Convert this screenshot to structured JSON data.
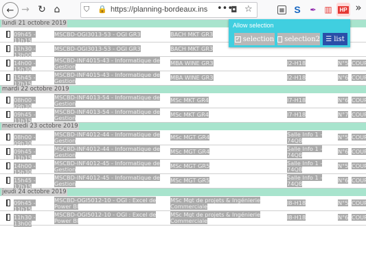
{
  "browser": {
    "url": "https://planning-bordeaux.ins",
    "back_glyph": "←",
    "forward_glyph": "→",
    "reload_glyph": "↻",
    "home_glyph": "⌂",
    "shield_glyph": "⛉",
    "lock_glyph": "🔒",
    "menu_glyph": "•••",
    "pocket_glyph": "◘",
    "star_glyph": "☆",
    "reader_glyph": "▦",
    "ext_s_glyph": "S",
    "ext_pen_glyph": "✒",
    "ext_cal_glyph": "▥",
    "ext_hp_label": "HP",
    "overflow_glyph": "»"
  },
  "popup": {
    "title": "Allow selection",
    "selection_label": "selection",
    "selection_checked": "✔",
    "selection2_label": "selection2",
    "list_label": "list",
    "list_icon": "☰"
  },
  "days": [
    {
      "label": "lundi 21 octobre 2019",
      "rows": [
        {
          "time": "09h45 - 11h15",
          "code": "MSCBD-OGI3013-53 - OGI GR3",
          "group": "BACH MKT GR3",
          "room": "",
          "n": "",
          "type": ""
        },
        {
          "time": "11h30 - 13h00",
          "code": "MSCBD-OGI3013-53 - OGI GR3",
          "group": "BACH MKT GR3",
          "room": "",
          "n": "",
          "type": ""
        },
        {
          "time": "14h00 - 15h30",
          "code": "MSCBD-INF4015-43 - Informatique de Gestion",
          "group": "MBA WINE GR3",
          "room": "I2-H18",
          "n": "N°5",
          "type": "COUR"
        },
        {
          "time": "15h45 - 17h15",
          "code": "MSCBD-INF4015-43 - Informatique de Gestion",
          "group": "MBA WINE GR3",
          "room": "I2-H18",
          "n": "N°6",
          "type": "COUR"
        }
      ]
    },
    {
      "label": "mardi 22 octobre 2019",
      "rows": [
        {
          "time": "08h00 - 09h30",
          "code": "MSCBD-INF4013-54 - Informatique de Gestion",
          "group": "MSc MKT GR4",
          "room": "I7-H18",
          "n": "N°6",
          "type": "COUR"
        },
        {
          "time": "09h45 - 11h15",
          "code": "MSCBD-INF4013-54 - Informatique de Gestion",
          "group": "MSc MKT GR4",
          "room": "I7-H18",
          "n": "N°7",
          "type": "COUR"
        }
      ]
    },
    {
      "label": "mercredi 23 octobre 2019",
      "rows": [
        {
          "time": "08h00 - 09h30",
          "code": "MSCBD-INF4012-44 - Informatique de Gestion",
          "group": "MSc MGT GR4",
          "room": "Salle Info 1 - 74QB",
          "n": "N°5",
          "type": "COUR"
        },
        {
          "time": "09h45 - 11h15",
          "code": "MSCBD-INF4012-44 - Informatique de Gestion",
          "group": "MSc MGT GR4",
          "room": "Salle Info 1 - 74QB",
          "n": "N°6",
          "type": "COUR"
        },
        {
          "time": "14h00 - 15h30",
          "code": "MSCBD-INF4012-45 - Informatique de Gestion",
          "group": "MSc MGT GR5",
          "room": "Salle Info 1 - 74QB",
          "n": "N°5",
          "type": "COUR"
        },
        {
          "time": "15h45 - 17h15",
          "code": "MSCBD-INF4012-45 - Informatique de Gestion",
          "group": "MSc MGT GR5",
          "room": "Salle Info 1 - 74QB",
          "n": "N°6",
          "type": "COUR"
        }
      ]
    },
    {
      "label": "jeudi 24 octobre 2019",
      "rows": [
        {
          "time": "09h45 - 11h15",
          "code": "MSCBD-OGI5012-10 - OGI : Excel de Power BI",
          "group": "MSc Mgt de projets & Ingénierie Commerciale",
          "room": "I8-H18",
          "n": "N°5",
          "type": "COUR"
        },
        {
          "time": "11h30 - 13h00",
          "code": "MSCBD-OGI5012-10 - OGI : Excel de Power BI",
          "group": "MSc Mgt de projets & Ingénierie Commerciale",
          "room": "I8-H18",
          "n": "N°6",
          "type": "COUR"
        }
      ]
    }
  ]
}
